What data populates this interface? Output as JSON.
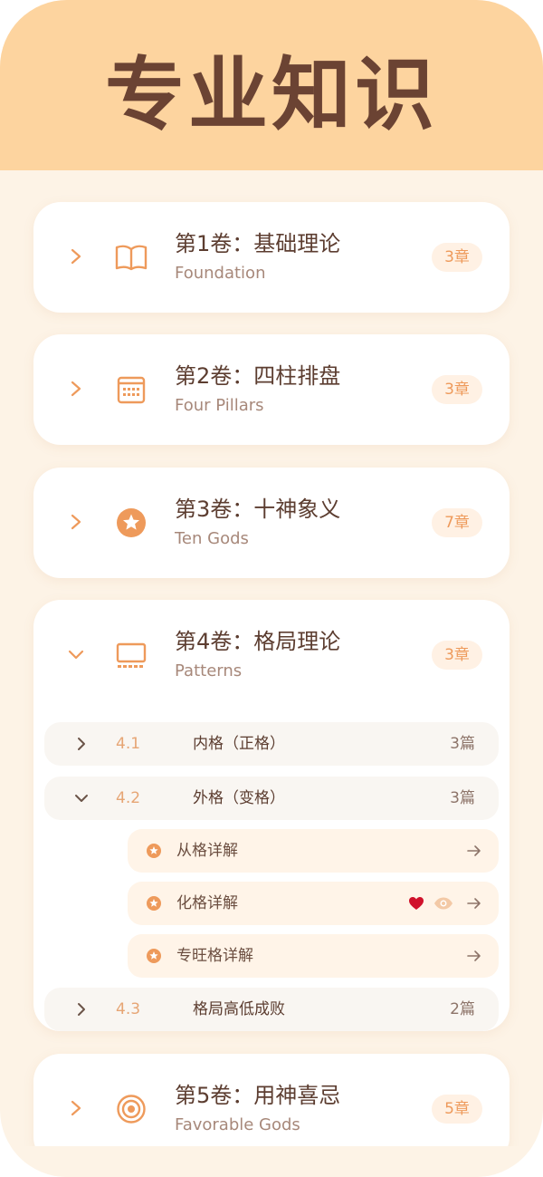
{
  "header": {
    "title": "专业知识"
  },
  "volumes": [
    {
      "title": "第1卷：基础理论",
      "subtitle": "Foundation",
      "badge": "3章",
      "icon": "book-open-icon",
      "expanded": false
    },
    {
      "title": "第2卷：四柱排盘",
      "subtitle": "Four Pillars",
      "badge": "3章",
      "icon": "calendar-icon",
      "expanded": false
    },
    {
      "title": "第3卷：十神象义",
      "subtitle": "Ten Gods",
      "badge": "7章",
      "icon": "star-circle-icon",
      "expanded": false
    },
    {
      "title": "第4卷：格局理论",
      "subtitle": "Patterns",
      "badge": "3章",
      "icon": "monitor-icon",
      "expanded": true,
      "chapters": [
        {
          "num": "4.1",
          "title": "内格（正格）",
          "count": "3篇",
          "expanded": false
        },
        {
          "num": "4.2",
          "title": "外格（变格）",
          "count": "3篇",
          "expanded": true,
          "articles": [
            {
              "title": "从格详解",
              "favorite": false,
              "viewed": false
            },
            {
              "title": "化格详解",
              "favorite": true,
              "viewed": true
            },
            {
              "title": "专旺格详解",
              "favorite": false,
              "viewed": false
            }
          ]
        },
        {
          "num": "4.3",
          "title": "格局高低成败",
          "count": "2篇",
          "expanded": false
        }
      ]
    },
    {
      "title": "第5卷：用神喜忌",
      "subtitle": "Favorable Gods",
      "badge": "5章",
      "icon": "target-icon",
      "expanded": false
    }
  ],
  "colors": {
    "header_bg": "#fdd49f",
    "page_bg": "#fdf3e6",
    "accent": "#ee9a5b",
    "title_text": "#5c3d30",
    "favorite": "#d0112b"
  }
}
